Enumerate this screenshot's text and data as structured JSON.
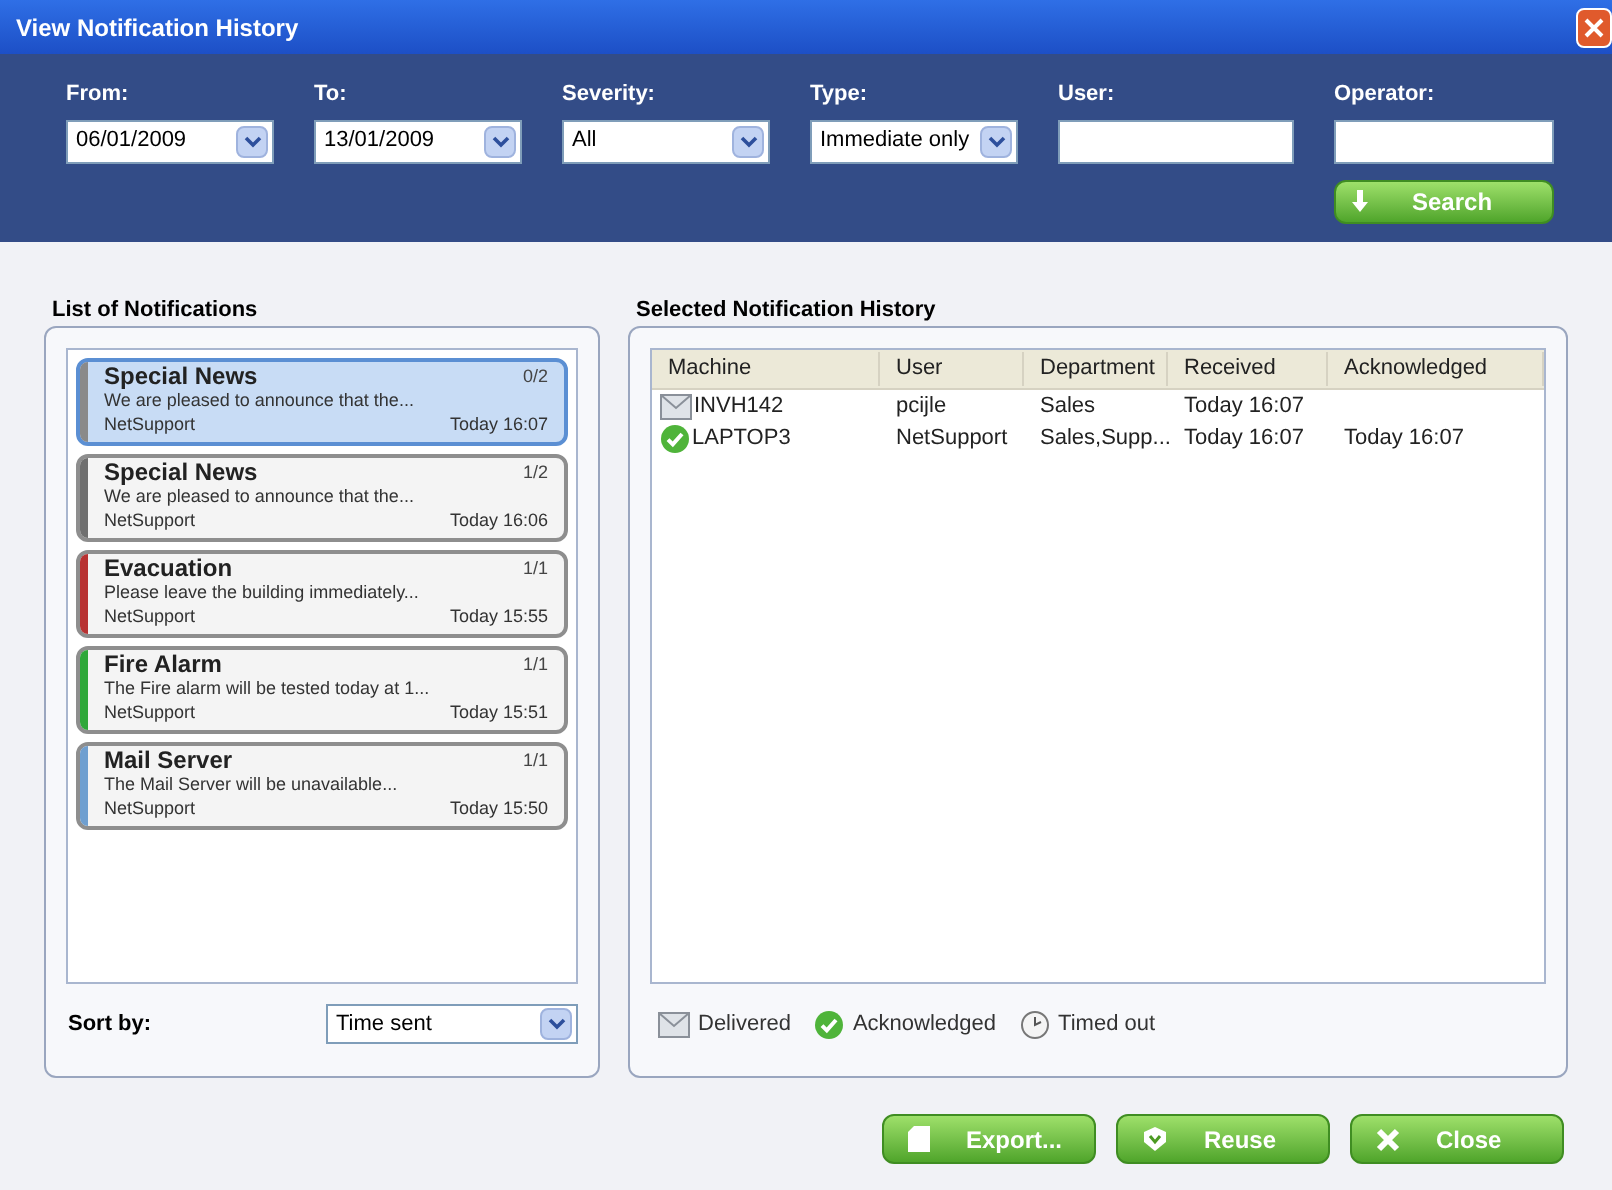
{
  "window": {
    "title": "View Notification History"
  },
  "filters": [
    {
      "label": "From:",
      "kind": "dropdown",
      "value": "06/01/2009"
    },
    {
      "label": "To:",
      "kind": "dropdown",
      "value": "13/01/2009"
    },
    {
      "label": "Severity:",
      "kind": "dropdown",
      "value": "All"
    },
    {
      "label": "Type:",
      "kind": "dropdown",
      "value": "Immediate only"
    },
    {
      "label": "User:",
      "kind": "text"
    },
    {
      "label": "Operator:",
      "kind": "text"
    }
  ],
  "search_button": "Search",
  "notifications_panel": {
    "title": "List of Notifications",
    "items": [
      {
        "title": "Special News",
        "count": "0/2",
        "message": "We are pleased to announce that the...",
        "sender": "NetSupport",
        "time": "Today 16:07",
        "color": "#8a8a8a",
        "selected": true
      },
      {
        "title": "Special News",
        "count": "1/2",
        "message": "We are pleased to announce that the...",
        "sender": "NetSupport",
        "time": "Today 16:06",
        "color": "#6f6f6f",
        "selected": false
      },
      {
        "title": "Evacuation",
        "count": "1/1",
        "message": "Please leave the building immediately...",
        "sender": "NetSupport",
        "time": "Today 15:55",
        "color": "#b83232",
        "selected": false
      },
      {
        "title": "Fire Alarm",
        "count": "1/1",
        "message": "The Fire alarm will be tested today at 1...",
        "sender": "NetSupport",
        "time": "Today 15:51",
        "color": "#2fa83a",
        "selected": false
      },
      {
        "title": "Mail Server",
        "count": "1/1",
        "message": "The Mail Server will be unavailable...",
        "sender": "NetSupport",
        "time": "Today 15:50",
        "color": "#6f9fd0",
        "selected": false
      }
    ],
    "sort_label": "Sort by:",
    "sort_value": "Time sent"
  },
  "history_panel": {
    "title": "Selected Notification History",
    "columns": [
      "Machine",
      "User",
      "Department",
      "Received",
      "Acknowledged"
    ],
    "rows": [
      {
        "kind": "delivered",
        "cells": [
          "INVH142",
          "pcijle",
          "Sales",
          "Today 16:07",
          null
        ]
      },
      {
        "kind": "acknowledged",
        "cells": [
          "LAPTOP3",
          "NetSupport",
          "Sales,Supp...",
          "Today 16:07",
          "Today 16:07"
        ]
      }
    ],
    "legend": [
      {
        "kind": "delivered",
        "label": "Delivered"
      },
      {
        "kind": "acknowledged",
        "label": "Acknowledged"
      },
      {
        "kind": "timedout",
        "label": "Timed out"
      }
    ]
  },
  "buttons": [
    {
      "kind": "export",
      "label": "Export..."
    },
    {
      "kind": "reuse",
      "label": "Reuse"
    },
    {
      "kind": "close",
      "label": "Close"
    }
  ]
}
